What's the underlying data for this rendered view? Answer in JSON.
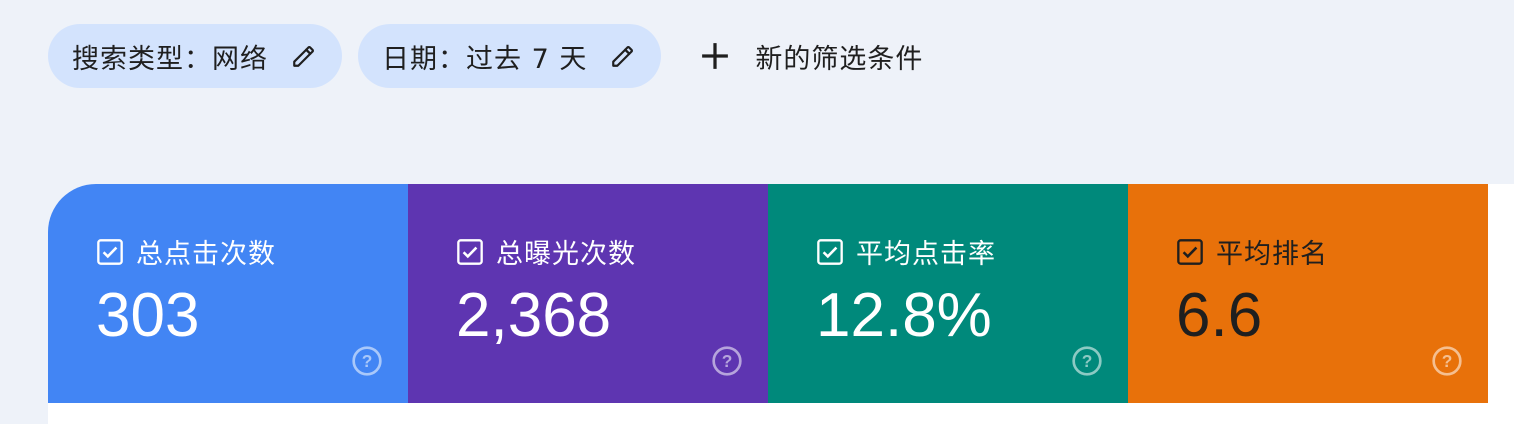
{
  "filters": [
    {
      "label": "搜索类型：网络",
      "edit_icon": "pencil-icon"
    },
    {
      "label": "日期：过去 7 天",
      "edit_icon": "pencil-icon"
    }
  ],
  "add_filter": {
    "label": "新的筛选条件",
    "icon": "plus-icon"
  },
  "metrics": [
    {
      "label": "总点击次数",
      "value": "303",
      "checked": true,
      "color": "#4285f4",
      "text_color": "#ffffff"
    },
    {
      "label": "总曝光次数",
      "value": "2,368",
      "checked": true,
      "color": "#5e35b1",
      "text_color": "#ffffff"
    },
    {
      "label": "平均点击率",
      "value": "12.8%",
      "checked": true,
      "color": "#00897b",
      "text_color": "#ffffff"
    },
    {
      "label": "平均排名",
      "value": "6.6",
      "checked": true,
      "color": "#e8710a",
      "text_color": "#1f1f1f"
    }
  ],
  "colors": {
    "page_background": "#eef2f9",
    "chip_background": "#d3e3fd"
  }
}
